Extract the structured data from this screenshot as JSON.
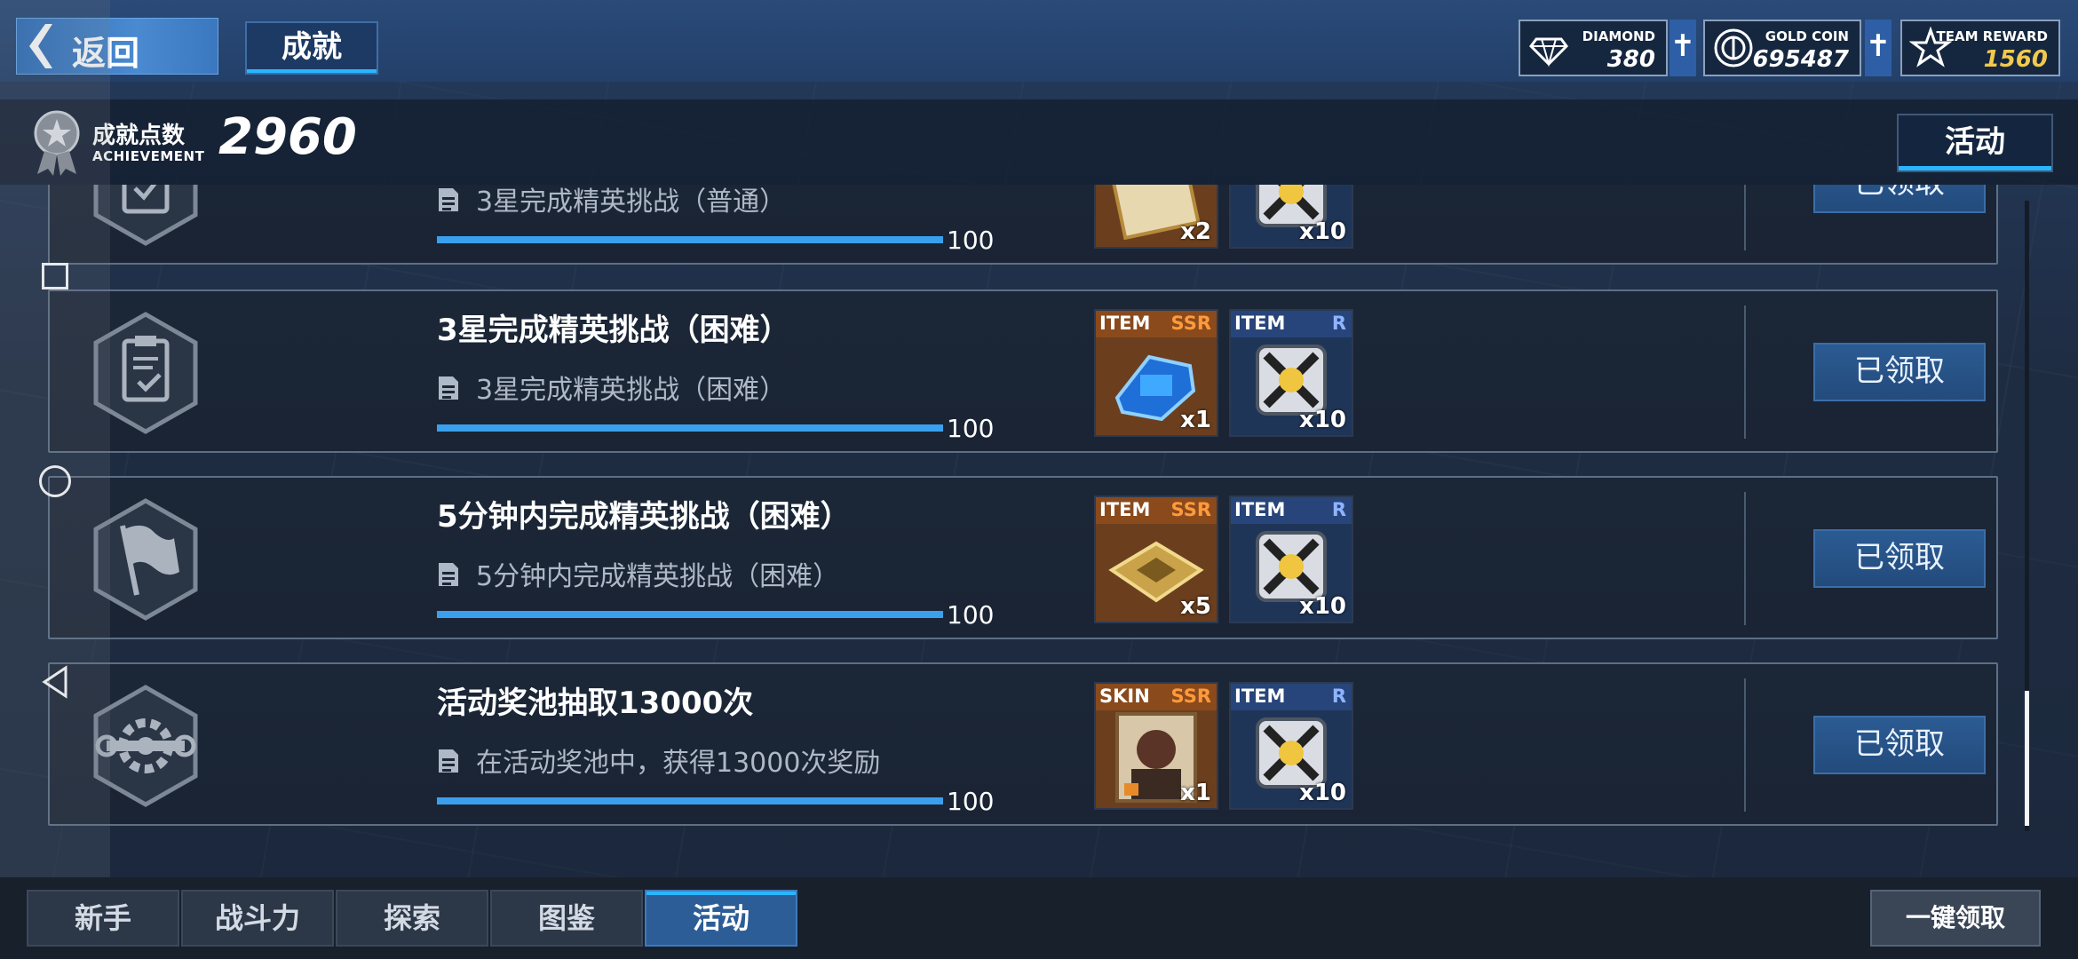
{
  "header": {
    "back_label": "返回",
    "title": "成就",
    "currencies": [
      {
        "name": "DIAMOND",
        "value": "380",
        "icon": "diamond-icon",
        "color": "#ffffff"
      },
      {
        "name": "GOLD COIN",
        "value": "695487",
        "icon": "gold-coin-icon",
        "color": "#ffffff"
      },
      {
        "name": "TEAM REWARD",
        "value": "1560",
        "icon": "team-reward-icon",
        "color": "#f2c94c"
      }
    ]
  },
  "achievement": {
    "label": "成就点数",
    "sub_label": "ACHIEVEMENT",
    "points": "2960",
    "event_tab": "活动"
  },
  "list": [
    {
      "icon": "clipboard-check-icon",
      "title": "",
      "desc": "3星完成精英挑战（普通）",
      "progress_value": "100",
      "progress_fraction": 1.0,
      "rewards": [
        {
          "type": "",
          "rank": "",
          "qty": "x2",
          "icon": "ticket-icon"
        },
        {
          "type": "",
          "rank": "",
          "qty": "x10",
          "icon": "supply-cube-icon"
        }
      ],
      "status": "已领取"
    },
    {
      "icon": "clipboard-check-icon",
      "title": "3星完成精英挑战（困难）",
      "desc": "3星完成精英挑战（困难）",
      "progress_value": "100",
      "progress_fraction": 1.0,
      "rewards": [
        {
          "type": "ITEM",
          "rank": "SSR",
          "qty": "x1",
          "icon": "blue-gear-chip-icon"
        },
        {
          "type": "ITEM",
          "rank": "R",
          "qty": "x10",
          "icon": "supply-cube-icon"
        }
      ],
      "status": "已领取"
    },
    {
      "icon": "flag-icon",
      "title": "5分钟内完成精英挑战（困难）",
      "desc": "5分钟内完成精英挑战（困难）",
      "progress_value": "100",
      "progress_fraction": 1.0,
      "rewards": [
        {
          "type": "ITEM",
          "rank": "SSR",
          "qty": "x5",
          "icon": "gold-plate-icon"
        },
        {
          "type": "ITEM",
          "rank": "R",
          "qty": "x10",
          "icon": "supply-cube-icon"
        }
      ],
      "status": "已领取"
    },
    {
      "icon": "gear-wrench-icon",
      "title": "活动奖池抽取13000次",
      "desc": "在活动奖池中，获得13000次奖励",
      "progress_value": "100",
      "progress_fraction": 1.0,
      "rewards": [
        {
          "type": "SKIN",
          "rank": "SSR",
          "qty": "x1",
          "icon": "character-skin-icon"
        },
        {
          "type": "ITEM",
          "rank": "R",
          "qty": "x10",
          "icon": "supply-cube-icon"
        }
      ],
      "status": "已领取"
    }
  ],
  "bottom_tabs": [
    {
      "label": "新手",
      "active": false
    },
    {
      "label": "战斗力",
      "active": false
    },
    {
      "label": "探索",
      "active": false
    },
    {
      "label": "图鉴",
      "active": false
    },
    {
      "label": "活动",
      "active": true
    }
  ],
  "claim_all_label": "一键领取",
  "colors": {
    "accent": "#29b6ff",
    "ssr": "#ff9a3c",
    "r": "#8fb4ff",
    "button": "#2b5b93"
  }
}
